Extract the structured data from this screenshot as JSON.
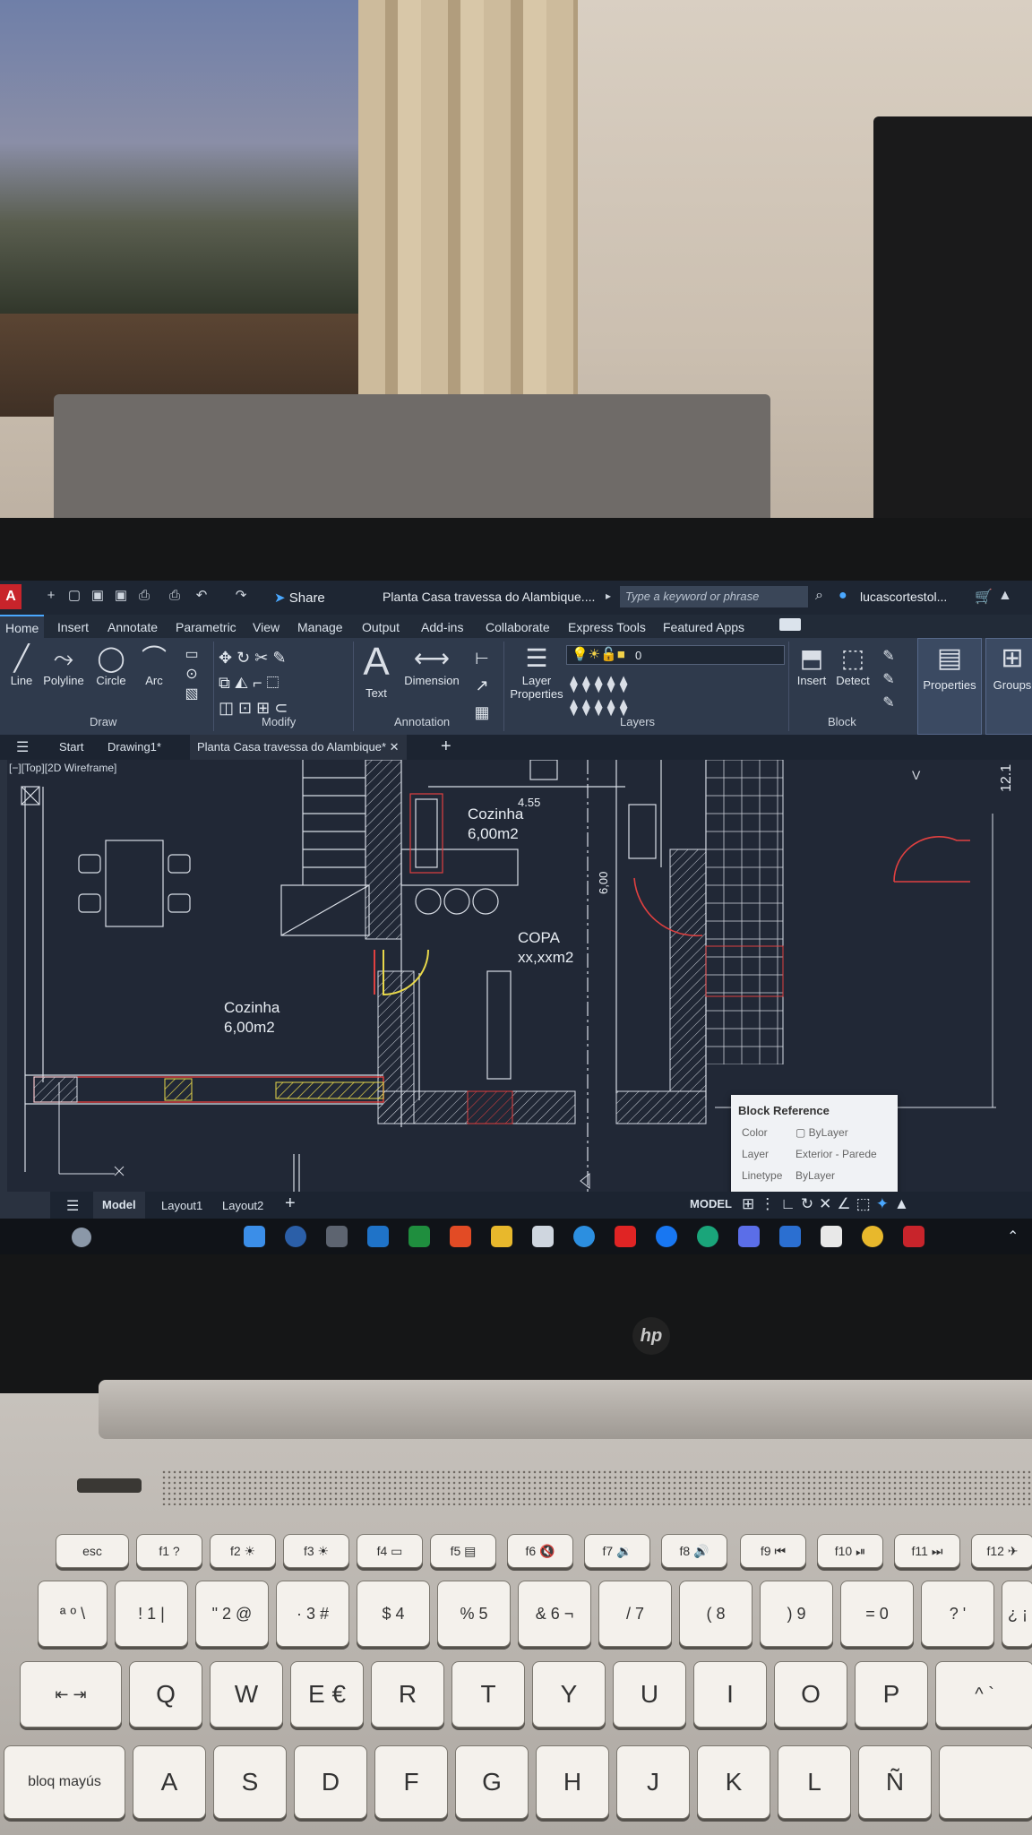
{
  "app": {
    "quick_access": [
      "+",
      "▢",
      "▣",
      "⎙",
      "↶",
      "↷"
    ],
    "share_label": "Share",
    "doc_title": "Planta Casa travessa do Alambique....",
    "search_placeholder": "Type a keyword or phrase",
    "user": "lucascortestol..."
  },
  "ribbon_tabs": [
    "Home",
    "Insert",
    "Annotate",
    "Parametric",
    "View",
    "Manage",
    "Output",
    "Add-ins",
    "Collaborate",
    "Express Tools",
    "Featured Apps"
  ],
  "ribbon": {
    "draw": {
      "line": "Line",
      "polyline": "Polyline",
      "circle": "Circle",
      "arc": "Arc",
      "panel": "Draw"
    },
    "modify": {
      "panel": "Modify"
    },
    "annotation": {
      "text": "Text",
      "dimension": "Dimension",
      "panel": "Annotation"
    },
    "layers": {
      "layer_properties": "Layer Properties",
      "panel": "Layers",
      "current_layer": "0"
    },
    "block": {
      "insert": "Insert",
      "detect": "Detect",
      "panel": "Block"
    },
    "properties": "Properties",
    "groups": "Groups"
  },
  "doc_tabs": [
    "Start",
    "Drawing1*",
    "Planta Casa travessa do Alambique*"
  ],
  "view_label": "[−][Top][2D Wireframe]",
  "drawing": {
    "dim_top": "4.55",
    "dim_vertical": "6,00",
    "dim_right": "12.1",
    "room1_name": "Cozinha",
    "room1_area": "6,00m2",
    "room2_name": "COPA",
    "room2_area": "xx,xxm2",
    "room3_name": "Cozinha",
    "room3_area": "6,00m2"
  },
  "tooltip": {
    "title": "Block Reference",
    "rows": [
      {
        "k": "Color",
        "v": "ByLayer"
      },
      {
        "k": "Layer",
        "v": "Exterior - Parede"
      },
      {
        "k": "Linetype",
        "v": "ByLayer"
      }
    ]
  },
  "layout_tabs": [
    "Model",
    "Layout1",
    "Layout2"
  ],
  "status": {
    "model": "MODEL"
  },
  "keyboard": {
    "row_f": [
      "esc",
      "f1 ?",
      "f2 ☀",
      "f3 ☀",
      "f4 ▭",
      "f5 ▤",
      "f6 🔇",
      "f7 🔉",
      "f8 🔊",
      "f9 ⏮",
      "f10 ⏯",
      "f11 ⏭",
      "f12 ✈"
    ],
    "row_num": [
      "ª º \\",
      "! 1 |",
      "\" 2 @",
      "· 3 #",
      "$ 4",
      "% 5",
      "& 6 ¬",
      "/ 7",
      "( 8",
      ") 9",
      "= 0",
      "? '",
      "¿ ¡"
    ],
    "row_q": [
      "⇤ ⇥",
      "Q",
      "W",
      "E €",
      "R",
      "T",
      "Y",
      "U",
      "I",
      "O",
      "P",
      "^ `"
    ],
    "row_a": [
      "bloq mayús",
      "A",
      "S",
      "D",
      "F",
      "G",
      "H",
      "J",
      "K",
      "L",
      "Ñ"
    ]
  }
}
